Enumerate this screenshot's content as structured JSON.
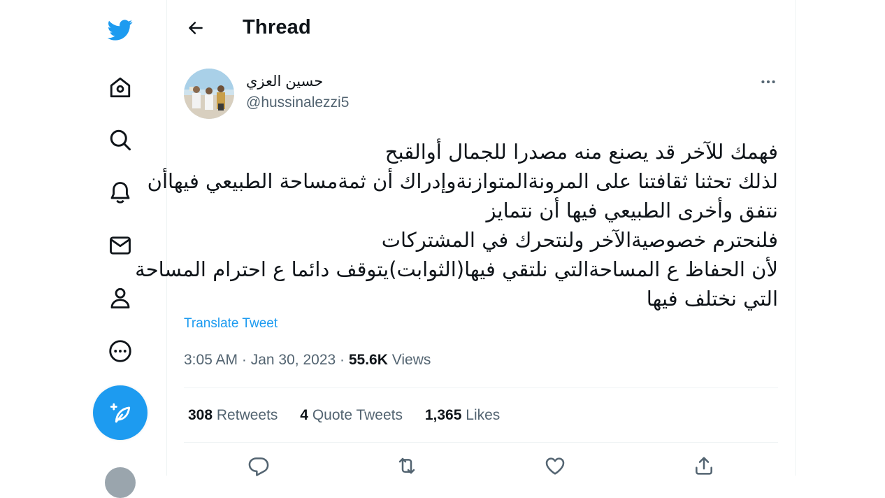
{
  "header": {
    "title": "Thread"
  },
  "author": {
    "name": "حسين العزي",
    "handle": "@hussinalezzi5"
  },
  "tweet": {
    "lines": [
      "فهمك للآخر قد يصنع منه مصدرا للجمال أوالقبح",
      "لذلك تحثنا ثقافتنا على المرونةالمتوازنةوإدراك أن ثمةمساحة الطبيعي فيهاأن",
      "نتفق وأخرى الطبيعي فيها أن نتمايز",
      "فلنحترم خصوصيةالآخر ولنتحرك في المشتركات",
      "لأن الحفاظ ع المساحةالتي نلتقي فيها(الثوابت)يتوقف دائما ع احترام المساحة",
      "التي نختلف فيها"
    ],
    "translate_label": "Translate Tweet",
    "time": "3:05 AM",
    "date": "Jan 30, 2023",
    "views_count": "55.6K",
    "views_label": "Views"
  },
  "stats": {
    "retweets_count": "308",
    "retweets_label": "Retweets",
    "quotes_count": "4",
    "quotes_label": "Quote Tweets",
    "likes_count": "1,365",
    "likes_label": "Likes"
  },
  "nav_icons": [
    "twitter-logo-icon",
    "home-icon",
    "explore-icon",
    "notifications-icon",
    "messages-icon",
    "profile-icon",
    "more-icon",
    "compose-icon"
  ],
  "action_icons": [
    "reply-icon",
    "retweet-icon",
    "like-icon",
    "share-icon"
  ],
  "colors": {
    "accent": "#1d9bf0",
    "text": "#0f1419",
    "secondary": "#536471",
    "border": "#eff3f4"
  }
}
